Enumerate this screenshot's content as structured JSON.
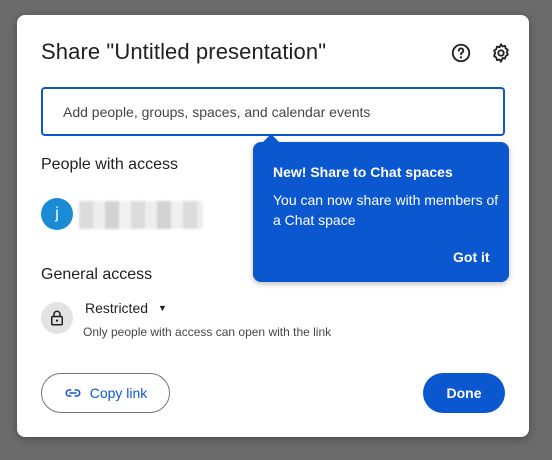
{
  "dialog": {
    "title": "Share \"Untitled presentation\"",
    "help_icon": "help-circle-icon",
    "settings_icon": "gear-icon"
  },
  "add_people": {
    "placeholder": "Add people, groups, spaces, and calendar events"
  },
  "people_with_access": {
    "heading": "People with access",
    "users": [
      {
        "avatar_letter": "j",
        "avatar_color": "#1a8bd4",
        "name_redacted": true
      }
    ]
  },
  "general_access": {
    "heading": "General access",
    "setting": "Restricted",
    "description": "Only people with access can open with the link",
    "icon": "lock-icon"
  },
  "footer": {
    "copy_link_label": "Copy link",
    "done_label": "Done"
  },
  "tooltip": {
    "title": "New! Share to Chat spaces",
    "body": "You can now share with members of a Chat space",
    "action_label": "Got it"
  },
  "colors": {
    "accent": "#0b57d0",
    "overlay": "#6b6b6b"
  }
}
